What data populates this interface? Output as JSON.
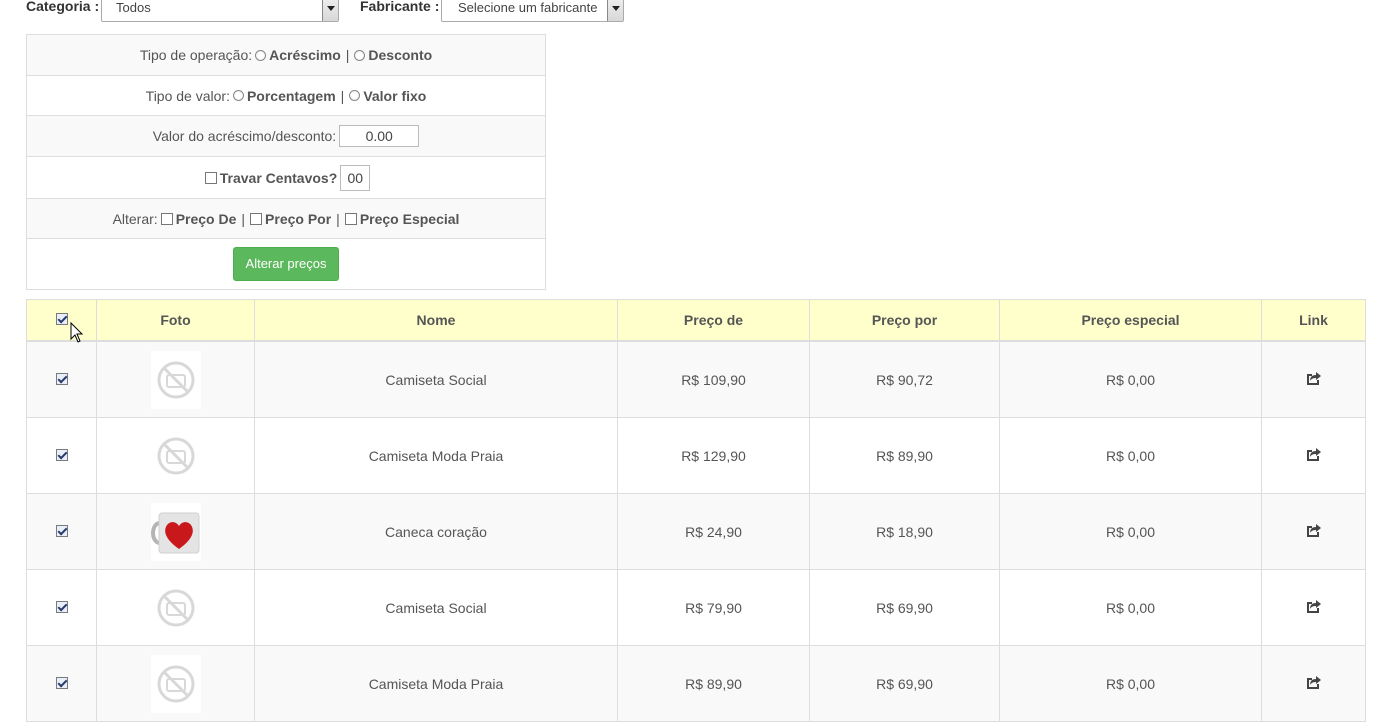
{
  "filters": {
    "category_label": "Categoria :",
    "category_value": "Todos",
    "manufacturer_label": "Fabricante :",
    "manufacturer_value": "Selecione um fabricante"
  },
  "panel": {
    "operation_label": "Tipo de operação:",
    "operation_options": [
      "Acréscimo",
      "Desconto"
    ],
    "value_type_label": "Tipo de valor:",
    "value_type_options": [
      "Porcentagem",
      "Valor fixo"
    ],
    "amount_label": "Valor do acréscimo/desconto:",
    "amount_value": "0.00",
    "lock_cents_label": "Travar Centavos?",
    "lock_cents_value": "00",
    "alter_label": "Alterar:",
    "alter_options": [
      "Preço De",
      "Preço Por",
      "Preço Especial"
    ],
    "separator": "|",
    "submit_label": "Alterar preços"
  },
  "table": {
    "headers": [
      "Foto",
      "Nome",
      "Preço de",
      "Preço por",
      "Preço especial",
      "Link"
    ],
    "rows": [
      {
        "name": "Camiseta Social",
        "preco_de": "R$ 109,90",
        "preco_por": "R$ 90,72",
        "preco_especial": "R$ 0,00",
        "image": "no-photo-icon"
      },
      {
        "name": "Camiseta Moda Praia",
        "preco_de": "R$ 129,90",
        "preco_por": "R$ 89,90",
        "preco_especial": "R$ 0,00",
        "image": "no-photo-icon"
      },
      {
        "name": "Caneca coração",
        "preco_de": "R$ 24,90",
        "preco_por": "R$ 18,90",
        "preco_especial": "R$ 0,00",
        "image": "heart-mug-photo"
      },
      {
        "name": "Camiseta Social",
        "preco_de": "R$ 79,90",
        "preco_por": "R$ 69,90",
        "preco_especial": "R$ 0,00",
        "image": "no-photo-icon"
      },
      {
        "name": "Camiseta Moda Praia",
        "preco_de": "R$ 89,90",
        "preco_por": "R$ 69,90",
        "preco_especial": "R$ 0,00",
        "image": "no-photo-icon"
      }
    ]
  },
  "colors": {
    "header_bg": "#ffffcc",
    "button_green": "#5cb85c",
    "border": "#dddddd"
  }
}
